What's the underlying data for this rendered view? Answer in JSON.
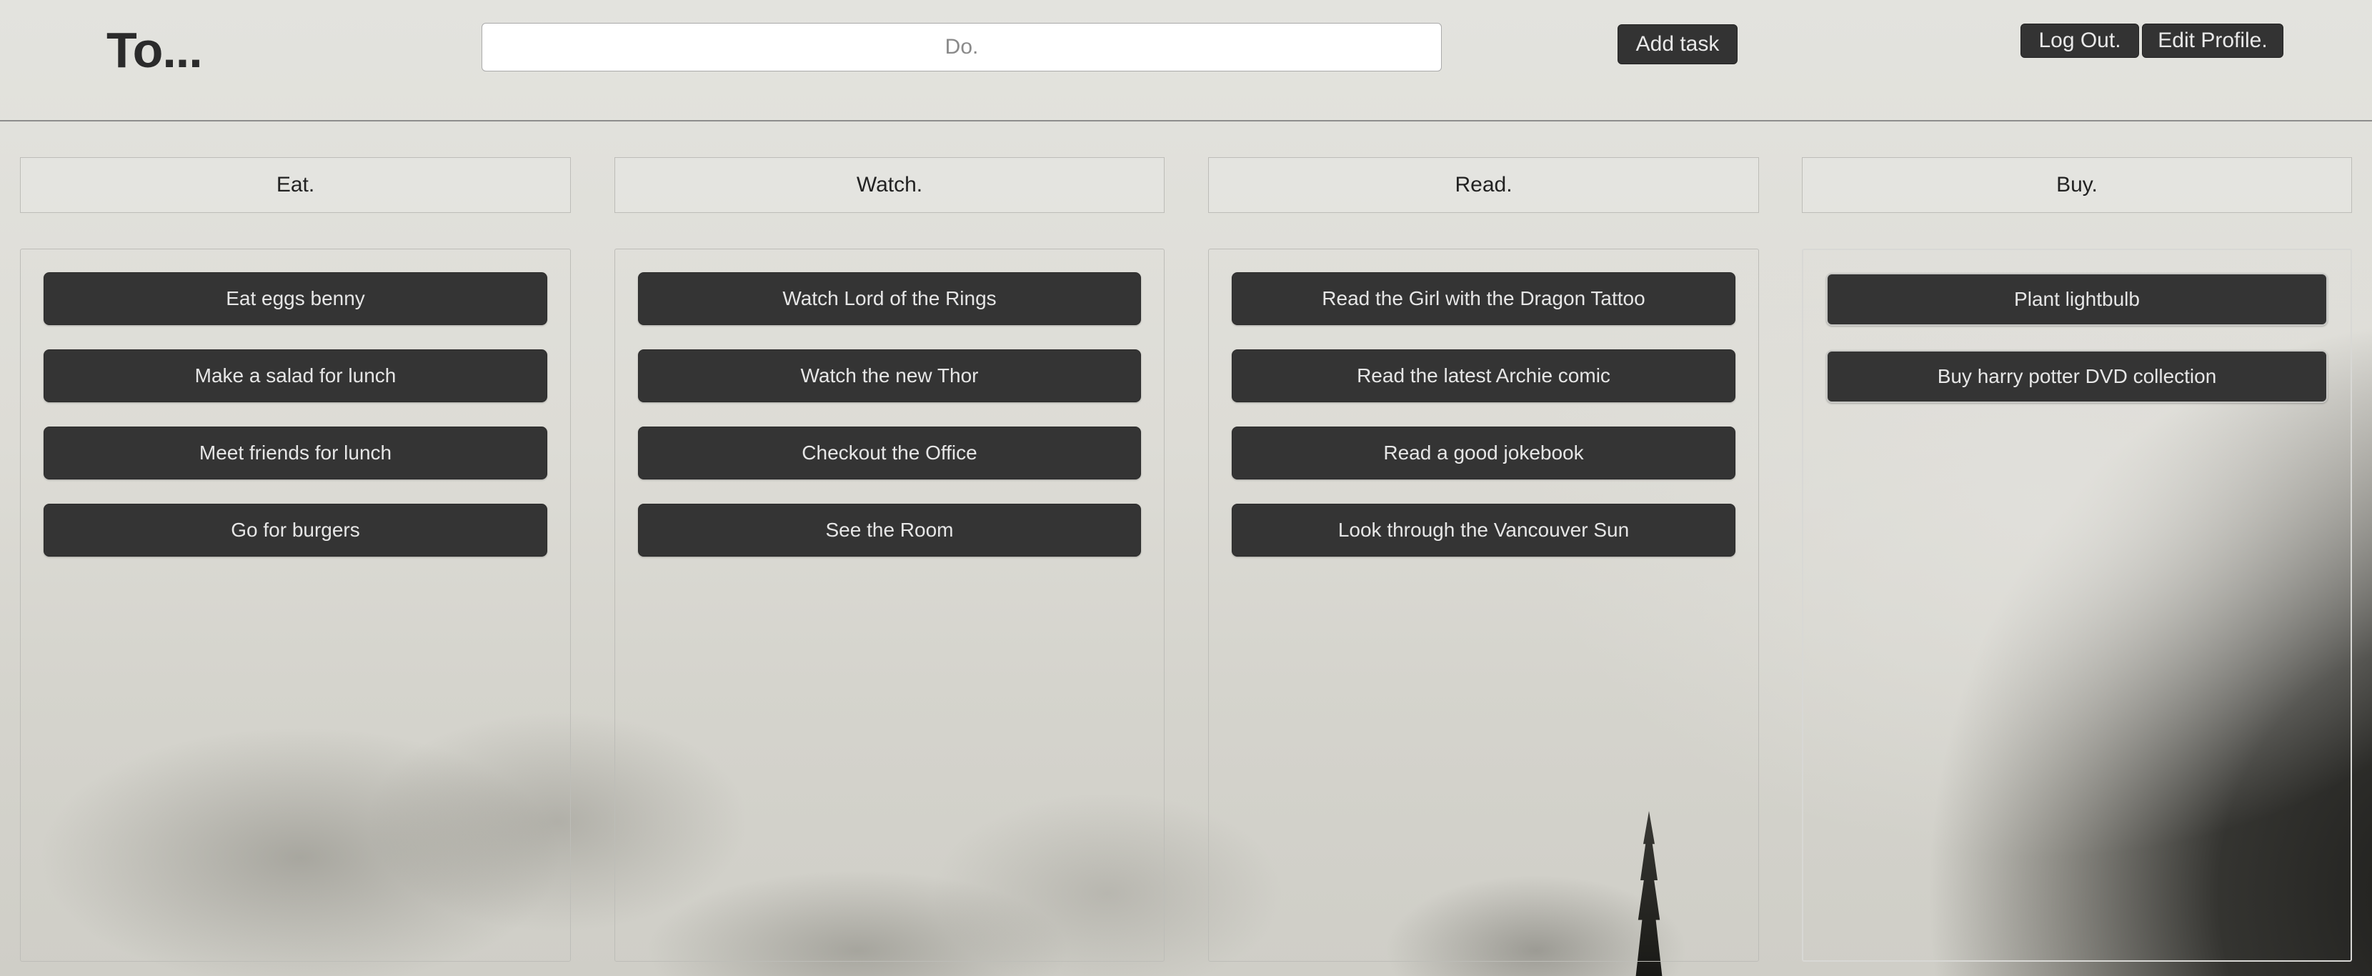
{
  "header": {
    "logo": "To...",
    "task_input_placeholder": "Do.",
    "add_task_label": "Add task",
    "logout_label": "Log Out.",
    "edit_profile_label": "Edit Profile."
  },
  "columns": [
    {
      "title": "Eat.",
      "tasks": [
        "Eat eggs benny",
        "Make a salad for lunch",
        "Meet friends for lunch",
        "Go for burgers"
      ]
    },
    {
      "title": "Watch.",
      "tasks": [
        "Watch Lord of the Rings",
        "Watch the new Thor",
        "Checkout the Office",
        "See the Room"
      ]
    },
    {
      "title": "Read.",
      "tasks": [
        "Read the Girl with the Dragon Tattoo",
        "Read the latest Archie comic",
        "Read a good jokebook",
        "Look through the Vancouver Sun"
      ]
    },
    {
      "title": "Buy.",
      "tasks": [
        "Plant lightbulb",
        "Buy harry potter DVD collection"
      ]
    }
  ]
}
